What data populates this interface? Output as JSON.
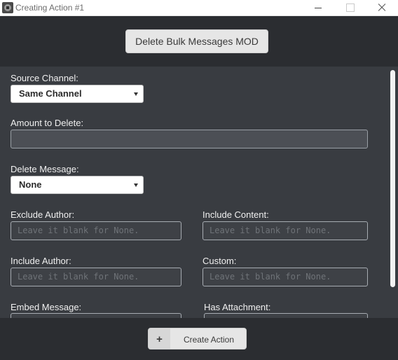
{
  "window": {
    "title": "Creating Action #1"
  },
  "header": {
    "mod_button_label": "Delete Bulk Messages MOD"
  },
  "form": {
    "source_channel": {
      "label": "Source Channel:",
      "value": "Same Channel"
    },
    "amount_to_delete": {
      "label": "Amount to Delete:",
      "value": ""
    },
    "delete_message": {
      "label": "Delete Message:",
      "value": "None"
    },
    "exclude_author": {
      "label": "Exclude Author:",
      "placeholder": "Leave it blank for None."
    },
    "include_content": {
      "label": "Include Content:",
      "placeholder": "Leave it blank for None."
    },
    "include_author": {
      "label": "Include Author:",
      "placeholder": "Leave it blank for None."
    },
    "custom": {
      "label": "Custom:",
      "placeholder": "Leave it blank for None."
    },
    "embed_message": {
      "label": "Embed Message:"
    },
    "has_attachment": {
      "label": "Has Attachment:"
    }
  },
  "footer": {
    "create_plus": "+",
    "create_label": "Create Action"
  },
  "colors": {
    "window_bg": "#2b2d31",
    "panel_bg": "#393c41",
    "button_bg": "#e6e6e6"
  }
}
